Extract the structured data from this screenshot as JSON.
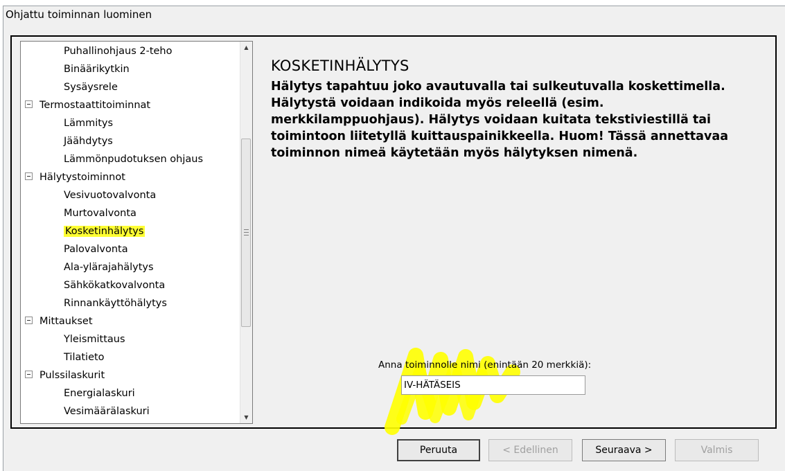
{
  "window": {
    "title": "Ohjattu toiminnan luominen"
  },
  "tree": {
    "items": [
      {
        "label": "Puhallinohjaus 2-teho",
        "level": 1
      },
      {
        "label": "Binäärikytkin",
        "level": 1
      },
      {
        "label": "Sysäysrele",
        "level": 1
      },
      {
        "label": "Termostaattitoiminnat",
        "level": 0,
        "expander": "minus-icon"
      },
      {
        "label": "Lämmitys",
        "level": 1
      },
      {
        "label": "Jäähdytys",
        "level": 1
      },
      {
        "label": "Lämmönpudotuksen ohjaus",
        "level": 1
      },
      {
        "label": "Hälytystoiminnot",
        "level": 0,
        "expander": "minus-icon"
      },
      {
        "label": "Vesivuotovalvonta",
        "level": 1
      },
      {
        "label": "Murtovalvonta",
        "level": 1
      },
      {
        "label": "Kosketinhälytys",
        "level": 1,
        "selected": true,
        "highlight": "#ffff33"
      },
      {
        "label": "Palovalvonta",
        "level": 1
      },
      {
        "label": "Ala-ylärajahälytys",
        "level": 1
      },
      {
        "label": "Sähkökatkovalvonta",
        "level": 1
      },
      {
        "label": "Rinnankäyttöhälytys",
        "level": 1
      },
      {
        "label": "Mittaukset",
        "level": 0,
        "expander": "minus-icon"
      },
      {
        "label": "Yleismittaus",
        "level": 1
      },
      {
        "label": "Tilatieto",
        "level": 1
      },
      {
        "label": "Pulssilaskurit",
        "level": 0,
        "expander": "minus-icon"
      },
      {
        "label": "Energialaskuri",
        "level": 1
      },
      {
        "label": "Vesimäärälaskuri",
        "level": 1
      }
    ]
  },
  "content": {
    "heading": "KOSKETINHÄLYTYS",
    "description": "Hälytys tapahtuu joko avautuvalla tai sulkeutuvalla koskettimella. Hälytystä voidaan indikoida myös releellä (esim. merkkilamppuohjaus). Hälytys voidaan kuitata tekstiviestillä tai toimintoon liitetyllä kuittauspainikkeella. Huom! Tässä annettavaa toiminnon nimeä käytetään myös hälytyksen nimenä.",
    "name_label": "Anna toiminnolle nimi (enintään 20 merkkiä):",
    "name_value": "IV-HÄTÄSEIS",
    "marker_color": "#ffff00"
  },
  "buttons": {
    "cancel": "Peruuta",
    "back": "< Edellinen",
    "next": "Seuraava >",
    "finish": "Valmis"
  }
}
